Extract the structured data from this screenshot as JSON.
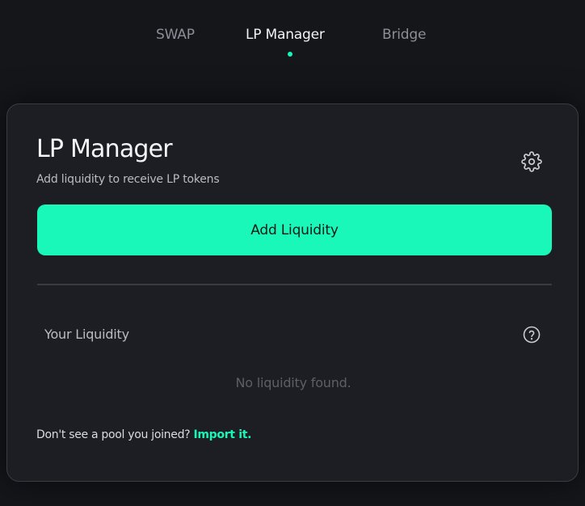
{
  "nav": {
    "tabs": [
      {
        "label": "SWAP",
        "active": false
      },
      {
        "label": "LP Manager",
        "active": true
      },
      {
        "label": "Bridge",
        "active": false
      }
    ]
  },
  "card": {
    "title": "LP Manager",
    "subtitle": "Add liquidity to receive LP tokens",
    "settings_icon": "gear-icon",
    "add_button_label": "Add Liquidity",
    "liquidity_label": "Your Liquidity",
    "help_icon": "question-circle-icon",
    "empty_message": "No liquidity found.",
    "import_prompt": "Don't see a pool you joined?",
    "import_link": "Import it."
  },
  "colors": {
    "background": "#15161a",
    "card_background": "#1d1e23",
    "accent": "#19f7b9",
    "muted_text": "#5c5f67"
  }
}
